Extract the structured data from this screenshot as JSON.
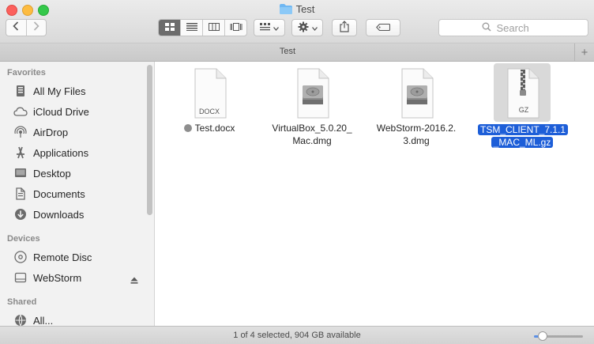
{
  "window": {
    "title": "Test",
    "tab_title": "Test",
    "tab_add_label": "+"
  },
  "toolbar": {
    "search_placeholder": "Search",
    "view_modes": [
      "icon-view",
      "list-view",
      "column-view",
      "cover-flow-view"
    ],
    "active_view": "icon-view"
  },
  "sidebar": {
    "sections": [
      {
        "header": "Favorites",
        "items": [
          {
            "label": "All My Files",
            "icon": "all-files-icon"
          },
          {
            "label": "iCloud Drive",
            "icon": "cloud-icon"
          },
          {
            "label": "AirDrop",
            "icon": "airdrop-icon"
          },
          {
            "label": "Applications",
            "icon": "applications-icon"
          },
          {
            "label": "Desktop",
            "icon": "desktop-icon"
          },
          {
            "label": "Documents",
            "icon": "documents-icon"
          },
          {
            "label": "Downloads",
            "icon": "downloads-icon"
          }
        ]
      },
      {
        "header": "Devices",
        "items": [
          {
            "label": "Remote Disc",
            "icon": "disc-icon"
          },
          {
            "label": "WebStorm",
            "icon": "drive-icon"
          }
        ]
      },
      {
        "header": "Shared",
        "items": [
          {
            "label": "All...",
            "icon": "network-icon"
          }
        ]
      }
    ]
  },
  "files": [
    {
      "line1": "Test.docx",
      "line2": "",
      "badge": "DOCX",
      "type": "document",
      "tagged": true,
      "selected": false
    },
    {
      "line1": "VirtualBox_5.0.20_",
      "line2": "Mac.dmg",
      "badge": "",
      "type": "disk-image",
      "tagged": false,
      "selected": false
    },
    {
      "line1": "WebStorm-2016.2.",
      "line2": "3.dmg",
      "badge": "",
      "type": "disk-image",
      "tagged": false,
      "selected": false
    },
    {
      "line1": "TSM_CLIENT_7.1.1",
      "line2": "_MAC_ML.gz",
      "badge": "GZ",
      "type": "archive",
      "tagged": false,
      "selected": true
    }
  ],
  "status": {
    "text": "1 of 4 selected, 904 GB available",
    "icon_size_level": 0.1
  },
  "colors": {
    "selection": "#1d5ed8",
    "close": "#fc605c",
    "minimize": "#fdbc40",
    "maximize": "#34c84a",
    "folder": "#6fb7f2"
  }
}
